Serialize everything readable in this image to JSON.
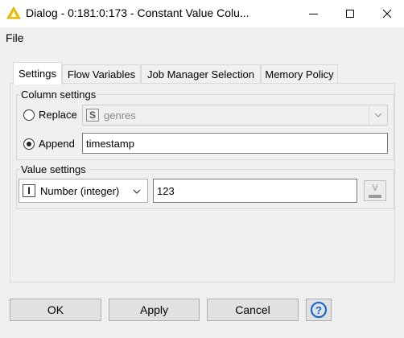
{
  "window": {
    "title": "Dialog - 0:181:0:173 - Constant Value Colu...",
    "icon": "warning-triangle-icon"
  },
  "menu": {
    "file": "File"
  },
  "tabs": [
    "Settings",
    "Flow Variables",
    "Job Manager Selection",
    "Memory Policy"
  ],
  "column_settings": {
    "label": "Column settings",
    "replace_label": "Replace",
    "replace_column_type": "S",
    "replace_column": "genres",
    "append_label": "Append",
    "append_value": "timestamp",
    "selected": "append"
  },
  "value_settings": {
    "label": "Value settings",
    "type_badge": "I",
    "type_label": "Number (integer)",
    "value": "123",
    "flow_var_badge": "V"
  },
  "buttons": {
    "ok": "OK",
    "apply": "Apply",
    "cancel": "Cancel",
    "help": "?"
  },
  "colors": {
    "accent": "#0a64d2",
    "icon_yellow": "#f2c200"
  }
}
